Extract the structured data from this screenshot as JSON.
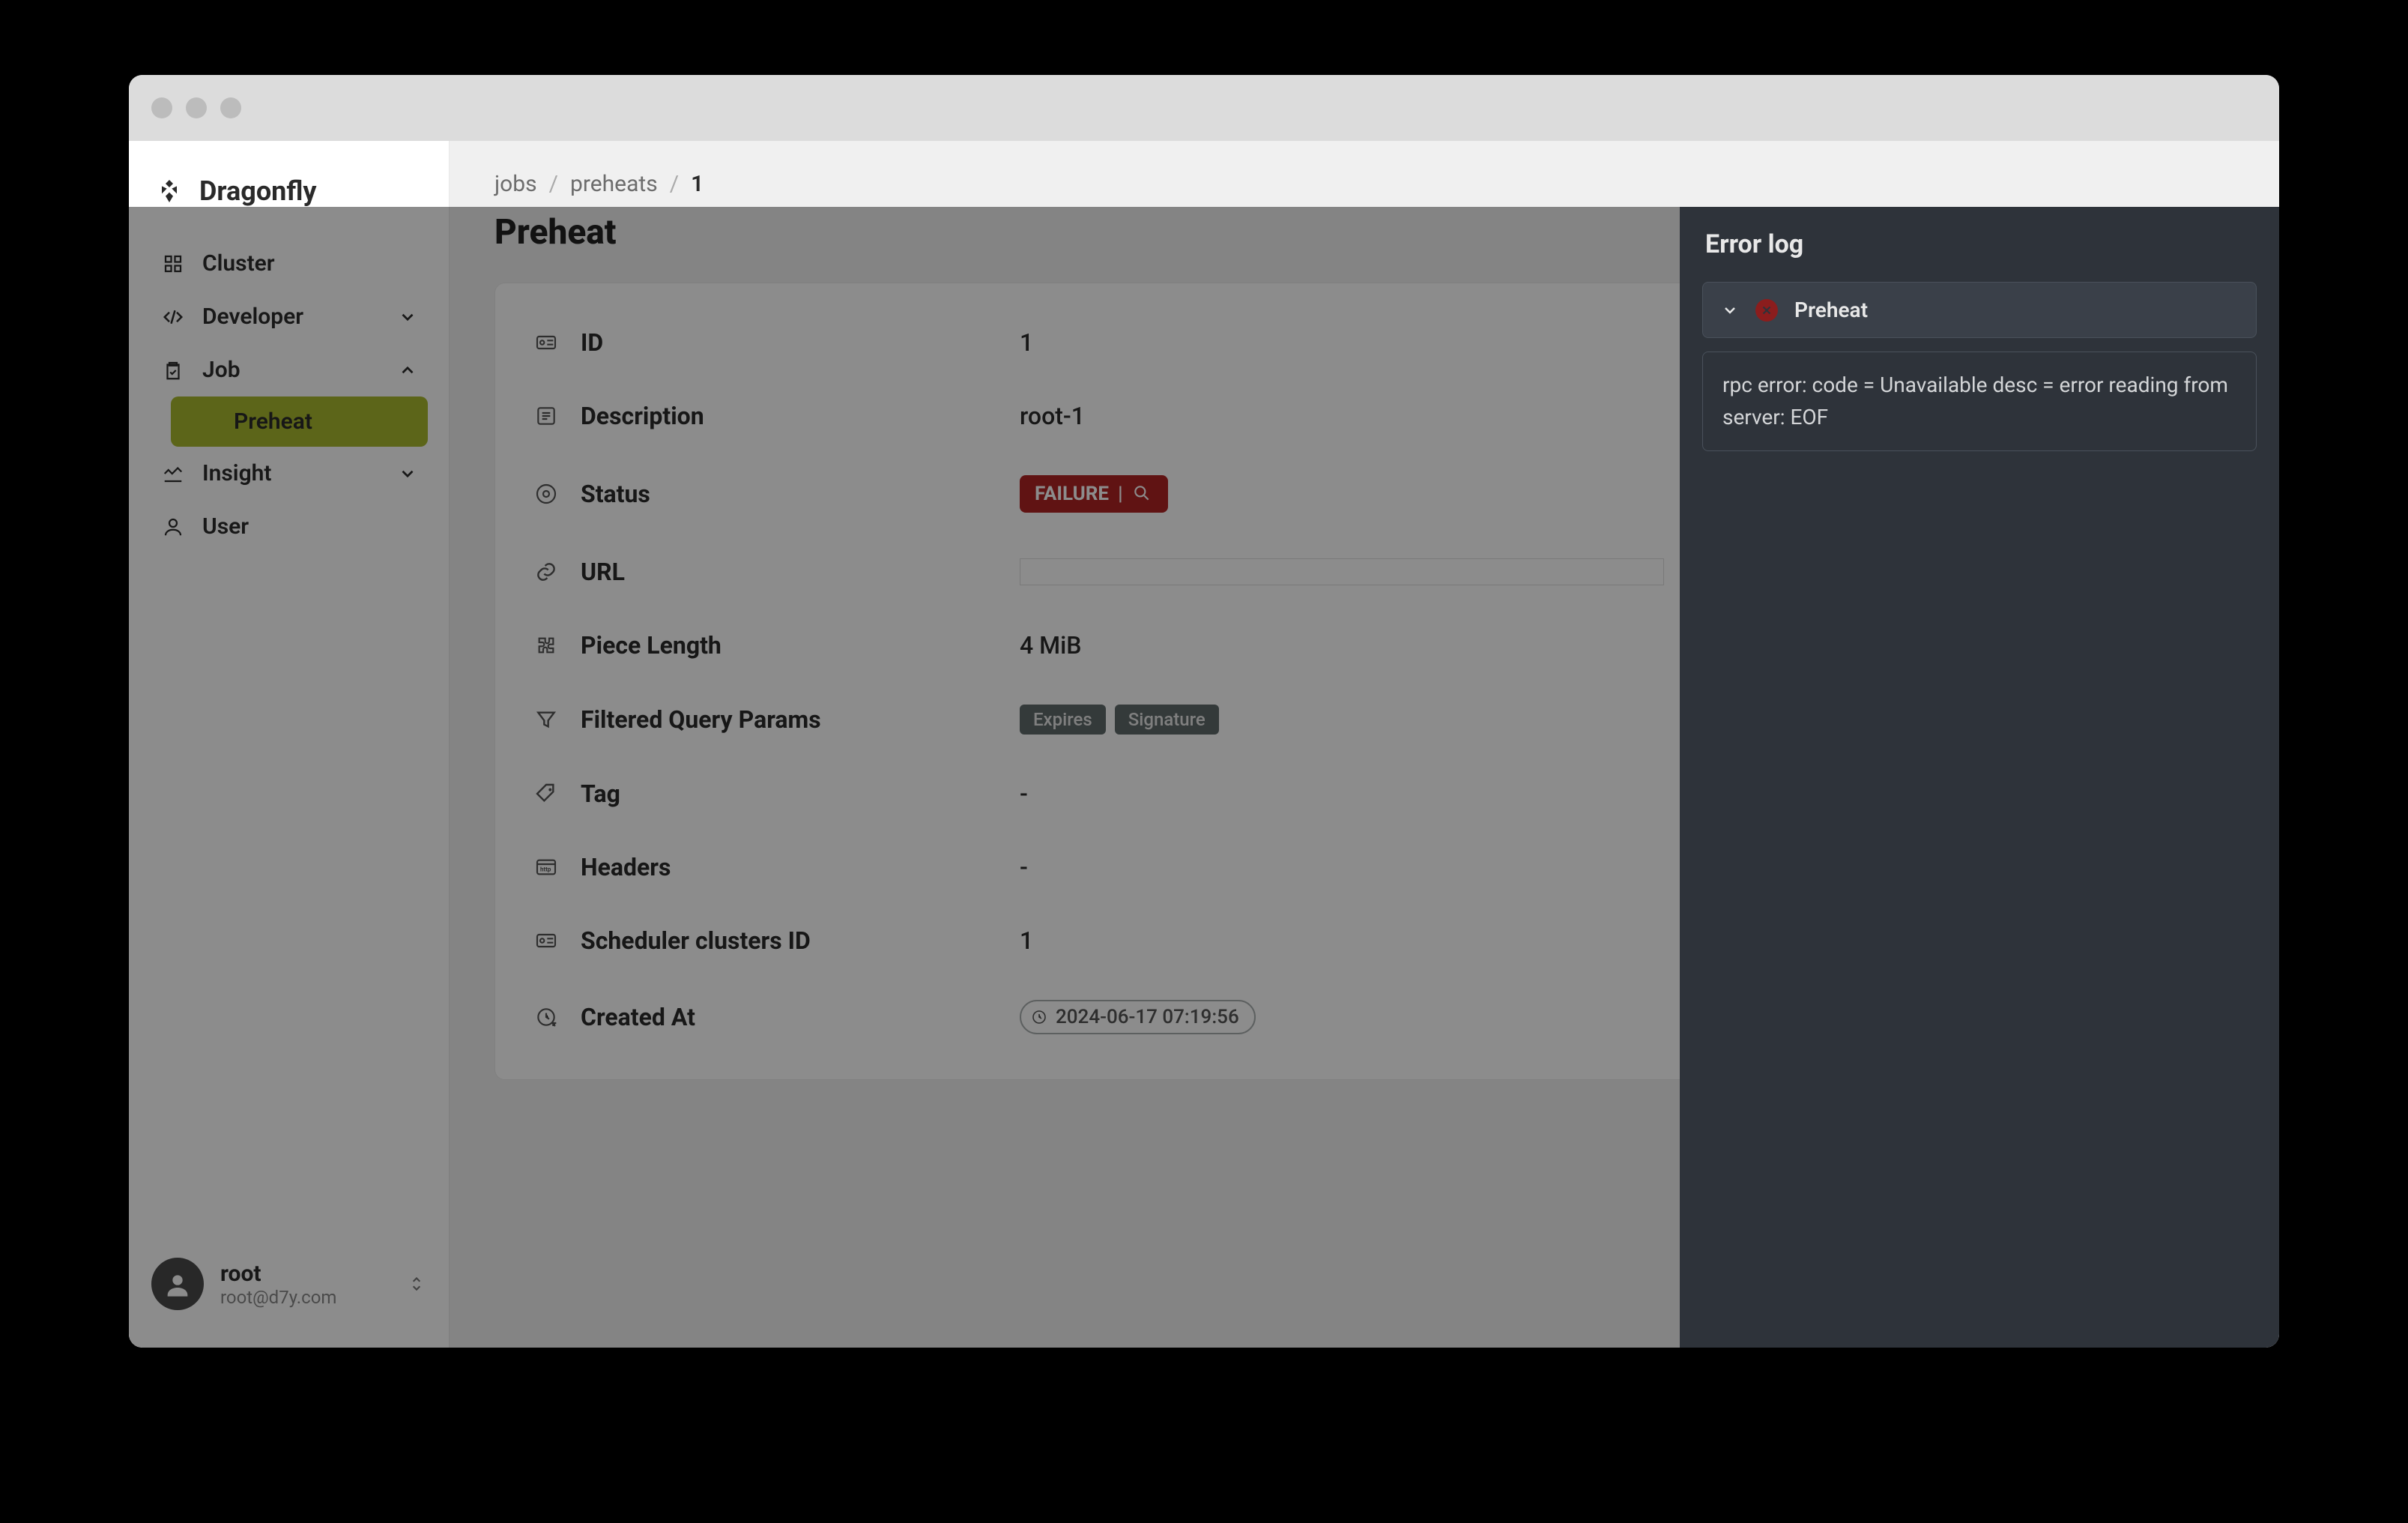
{
  "app_name": "Dragonfly",
  "sidebar": {
    "items": [
      {
        "label": "Cluster"
      },
      {
        "label": "Developer"
      },
      {
        "label": "Job"
      },
      {
        "label": "Preheat"
      },
      {
        "label": "Insight"
      },
      {
        "label": "User"
      }
    ]
  },
  "user": {
    "name": "root",
    "email": "root@d7y.com"
  },
  "breadcrumb": {
    "a": "jobs",
    "b": "preheats",
    "c": "1"
  },
  "page_title": "Preheat",
  "details": {
    "id_label": "ID",
    "id_value": "1",
    "desc_label": "Description",
    "desc_value": "root-1",
    "status_label": "Status",
    "status_value": "FAILURE",
    "url_label": "URL",
    "piece_label": "Piece Length",
    "piece_value": "4 MiB",
    "filtered_label": "Filtered Query Params",
    "filtered_chips": [
      "Expires",
      "Signature"
    ],
    "tag_label": "Tag",
    "tag_value": "-",
    "headers_label": "Headers",
    "headers_value": "-",
    "scheduler_label": "Scheduler clusters ID",
    "scheduler_value": "1",
    "created_label": "Created At",
    "created_value": "2024-06-17 07:19:56"
  },
  "panel": {
    "title": "Error log",
    "section": "Preheat",
    "message": "rpc error: code = Unavailable desc = error reading from server: EOF"
  }
}
